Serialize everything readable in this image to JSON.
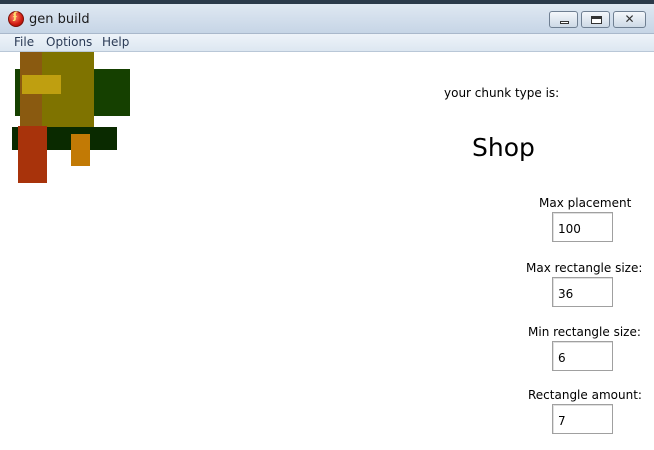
{
  "window": {
    "title": "gen build",
    "close_glyph": "✕"
  },
  "menu": {
    "items": [
      "File",
      "Options",
      "Help"
    ]
  },
  "panel": {
    "chunk_label": "your chunk type is:",
    "chunk_type": "Shop",
    "fields": [
      {
        "label": "Max placement",
        "value": "100"
      },
      {
        "label": "Max rectangle size:",
        "value": "36"
      },
      {
        "label": "Min rectangle size:",
        "value": "6"
      },
      {
        "label": "Rectangle amount:",
        "value": "7"
      }
    ]
  },
  "colors": {
    "dark_green": "#154000",
    "very_dark_green": "#0a2a00",
    "olive": "#7f7300",
    "brown": "#8a5a10",
    "gold": "#bf9f10",
    "rust": "#a8330b",
    "orange": "#c27a05"
  }
}
